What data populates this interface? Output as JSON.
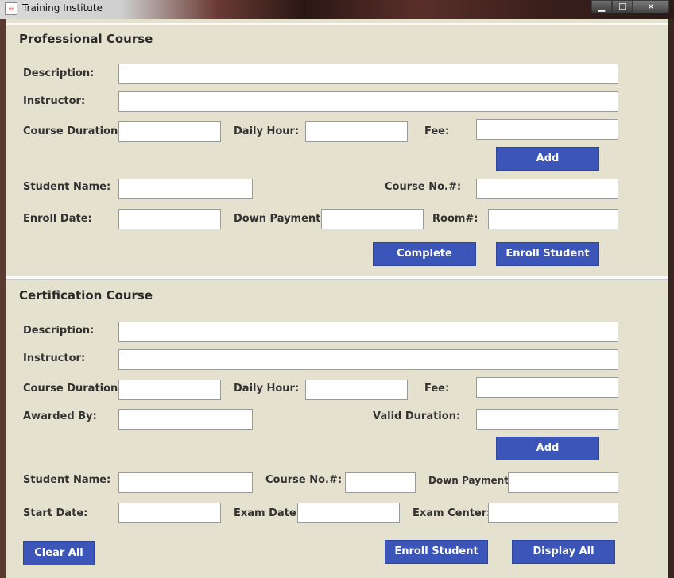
{
  "window": {
    "title": "Training Institute",
    "minimize_glyph": "▁",
    "maximize_glyph": "☐",
    "close_glyph": "✕"
  },
  "professional": {
    "heading": "Professional Course",
    "description_label": "Description:",
    "description_value": "",
    "instructor_label": "Instructor:",
    "instructor_value": "",
    "duration_label": "Course Duration:",
    "duration_value": "",
    "daily_hour_label": "Daily Hour:",
    "daily_hour_value": "",
    "fee_label": "Fee:",
    "fee_value": "",
    "add_label": "Add",
    "student_name_label": "Student Name:",
    "student_name_value": "",
    "course_no_label": "Course No.#:",
    "course_no_value": "",
    "enroll_date_label": "Enroll Date:",
    "enroll_date_value": "",
    "down_payment_label": "Down Payment:",
    "down_payment_value": "",
    "room_label": "Room#:",
    "room_value": "",
    "complete_label": "Complete",
    "enroll_label": "Enroll Student"
  },
  "certification": {
    "heading": "Certification Course",
    "description_label": "Description:",
    "description_value": "",
    "instructor_label": "Instructor:",
    "instructor_value": "",
    "duration_label": "Course Duration:",
    "duration_value": "",
    "daily_hour_label": "Daily Hour:",
    "daily_hour_value": "",
    "fee_label": "Fee:",
    "fee_value": "",
    "awarded_by_label": "Awarded By:",
    "awarded_by_value": "",
    "valid_duration_label": "Valid Duration:",
    "valid_duration_value": "",
    "add_label": "Add",
    "student_name_label": "Student Name:",
    "student_name_value": "",
    "course_no_label": "Course No.#:",
    "course_no_value": "",
    "down_payment_label": "Down Payment:",
    "down_payment_value": "",
    "start_date_label": "Start Date:",
    "start_date_value": "",
    "exam_date_label": "Exam Date:",
    "exam_date_value": "",
    "exam_center_label": "Exam Center:",
    "exam_center_value": "",
    "clear_all_label": "Clear All",
    "enroll_label": "Enroll Student",
    "display_all_label": "Display All"
  },
  "colors": {
    "button_bg": "#3b55b8",
    "panel_bg": "#e4e2ce"
  }
}
